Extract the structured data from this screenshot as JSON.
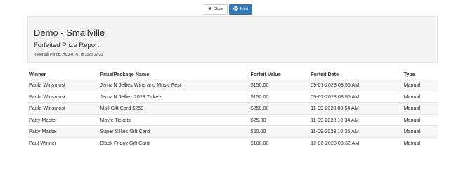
{
  "toolbar": {
    "close_label": "Close",
    "print_label": "Print",
    "close_icon": "close-icon",
    "print_icon": "print-icon"
  },
  "colors": {
    "primary": "#337ab7",
    "header_bg": "#f4f4f4",
    "row_alt": "#f7f7f7"
  },
  "header": {
    "org_name": "Demo - Smallville",
    "report_title": "Forfeited Prize Report",
    "period": "Reporting Period: 2023-01-01 to 2023-12-31"
  },
  "table": {
    "columns": [
      "Winner",
      "Prize/Package Name",
      "Forfeit Value",
      "Forfeit Date",
      "Type"
    ],
    "rows": [
      [
        "Paula Winsmost",
        "Jamz N Jellies Wine and Music Fest",
        "$150.00",
        "09-07-2023 08:55 AM",
        "Manual"
      ],
      [
        "Paula Winsmost",
        "Jamz N Jelliez 2023 Tickets",
        "$150.00",
        "09-07-2023 08:55 AM",
        "Manual"
      ],
      [
        "Paula Winsmost",
        "Mall Gift Card $250",
        "$250.00",
        "11-09-2023 08:54 AM",
        "Manual"
      ],
      [
        "Patty Mastel",
        "Movie Tickets",
        "$25.00",
        "11-09-2023 10:34 AM",
        "Manual"
      ],
      [
        "Patty Mastel",
        "Super Sillies Gift Card",
        "$50.00",
        "11-09-2023 10:35 AM",
        "Manual"
      ],
      [
        "Paul Winner",
        "Black Friday Gift Card",
        "$100.00",
        "12-06-2023 03:32 AM",
        "Manual"
      ]
    ]
  }
}
